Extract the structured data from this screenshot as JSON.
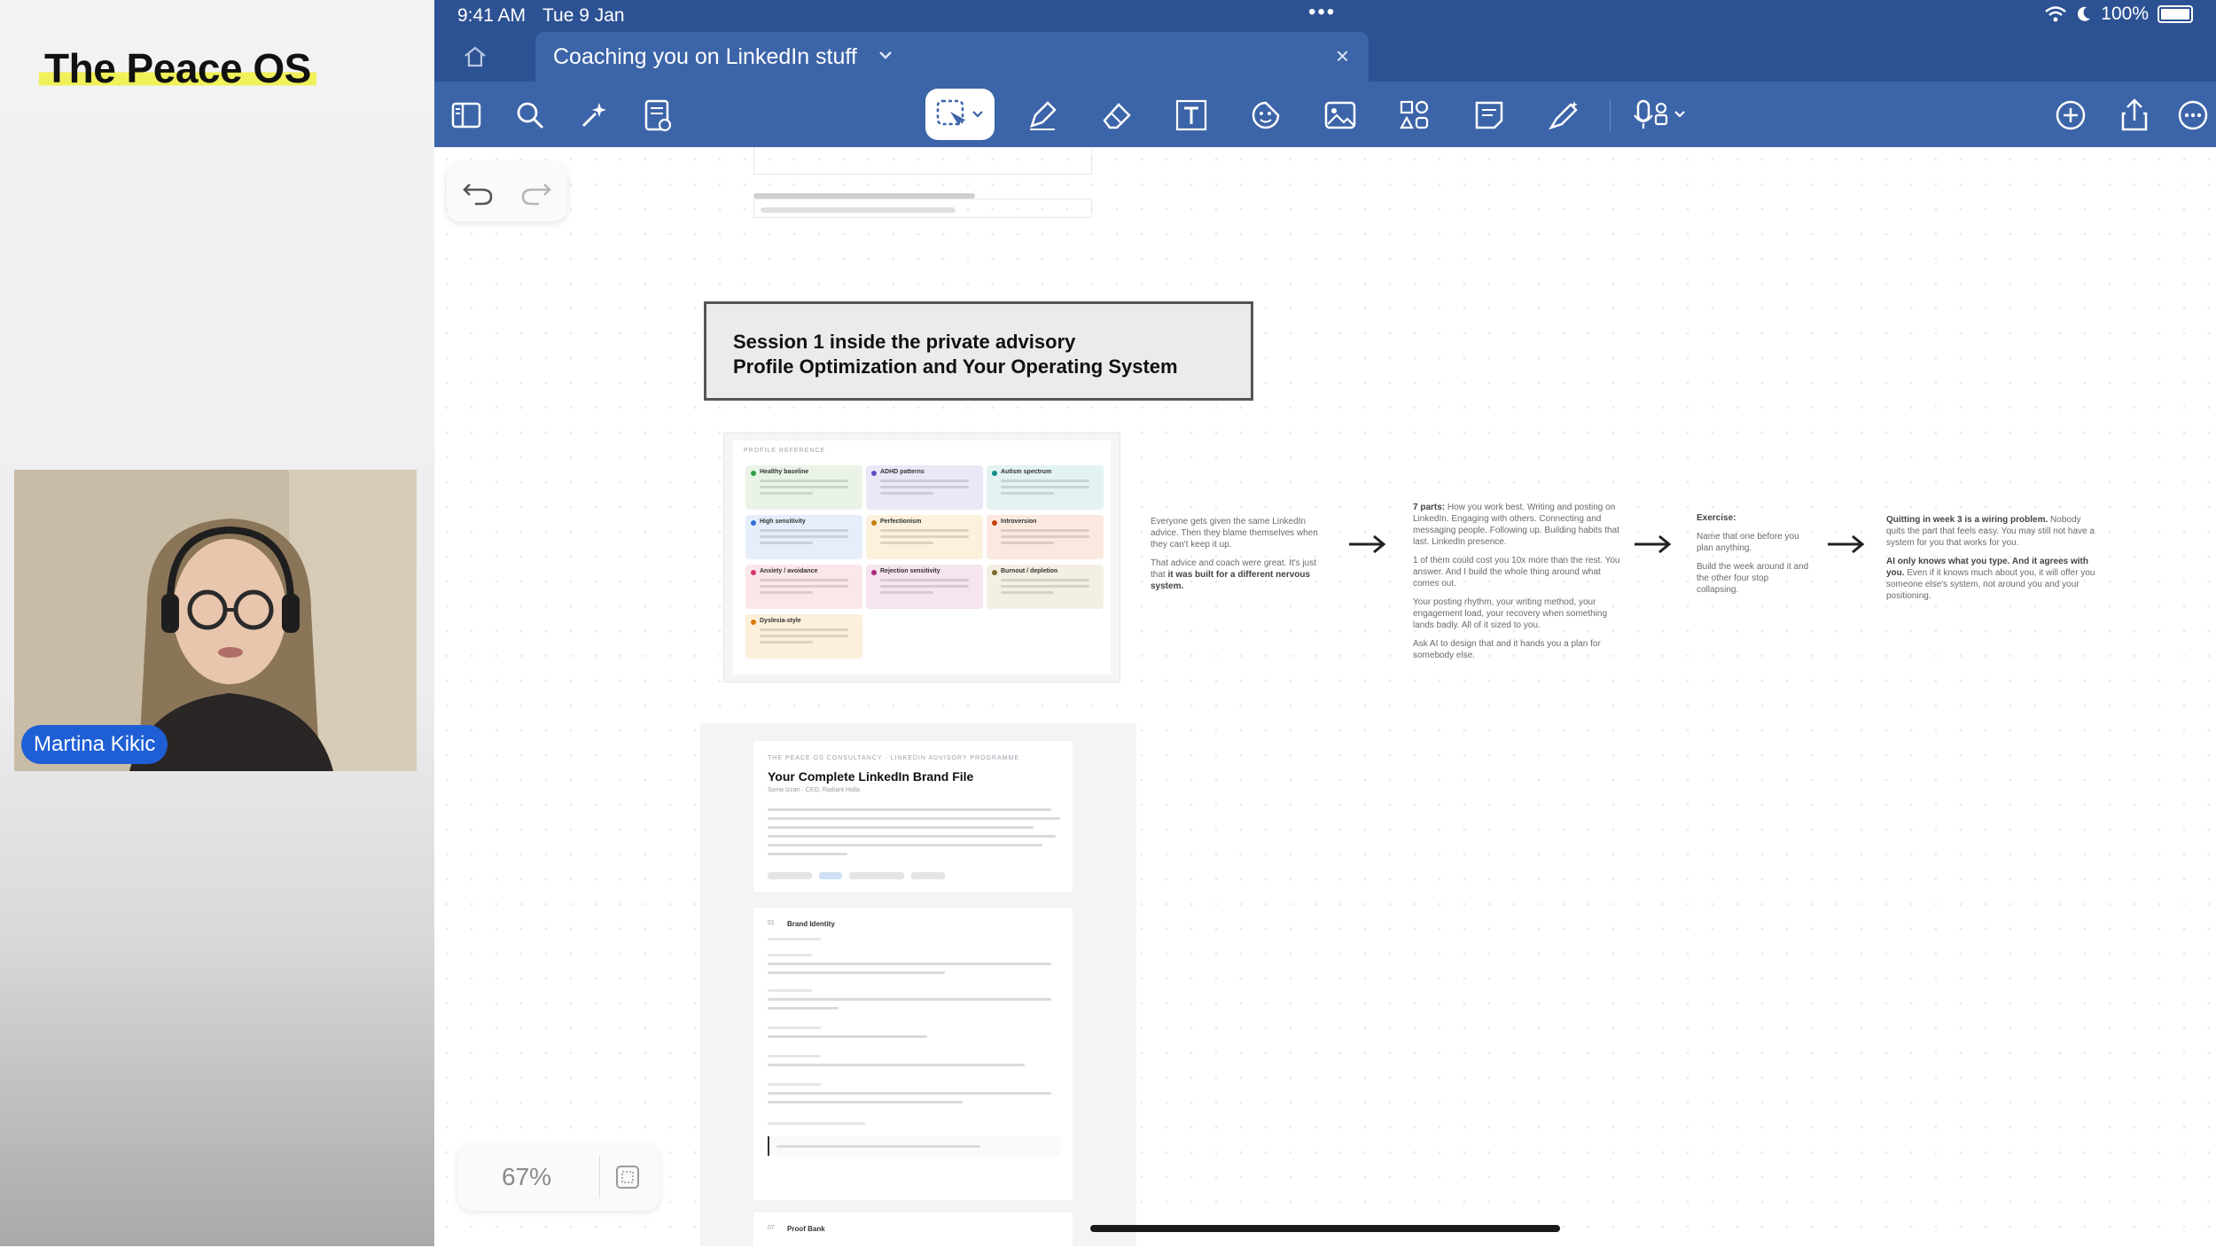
{
  "brand": {
    "title": "The Peace OS"
  },
  "presenter": {
    "name": "Martina Kikic"
  },
  "status_bar": {
    "time": "9:41 AM",
    "date": "Tue 9 Jan",
    "battery": "100%"
  },
  "tab": {
    "title": "Coaching you on LinkedIn stuff"
  },
  "toolbar": {
    "left_tools": [
      "sidebar-icon",
      "search-icon",
      "sparkle-icon",
      "page-icon"
    ],
    "center_tools": [
      "lasso-icon",
      "pen-icon",
      "eraser-icon",
      "text-box-icon",
      "sticker-icon",
      "image-icon",
      "shapes-icon",
      "sticky-note-icon",
      "highlighter-icon",
      "microphone-icon"
    ],
    "right_tools": [
      "add-icon",
      "share-icon",
      "more-icon"
    ],
    "active_tool": "lasso-icon"
  },
  "session": {
    "line1": "Session 1 inside the private advisory",
    "line2": "Profile Optimization and Your Operating System"
  },
  "profile_card": {
    "header": "PROFILE REFERENCE",
    "cards": [
      {
        "title": "Healthy baseline",
        "dot": "#2f9e44",
        "bg": "#e9f4e6"
      },
      {
        "title": "ADHD patterns",
        "dot": "#5b4fc7",
        "bg": "#ebe7f6"
      },
      {
        "title": "Autism spectrum",
        "dot": "#138a8a",
        "bg": "#e3f3f1"
      },
      {
        "title": "High sensitivity",
        "dot": "#2f6fd6",
        "bg": "#e6eefb"
      },
      {
        "title": "Perfectionism",
        "dot": "#c77d0a",
        "bg": "#fbf1dd"
      },
      {
        "title": "Introversion",
        "dot": "#c2410c",
        "bg": "#fbe9e0"
      },
      {
        "title": "Anxiety / avoidance",
        "dot": "#d6336c",
        "bg": "#fbe6ea"
      },
      {
        "title": "Rejection sensitivity",
        "dot": "#b02a7a",
        "bg": "#f6e4ef"
      },
      {
        "title": "Burnout / depletion",
        "dot": "#7a6a2f",
        "bg": "#f3efe2"
      },
      {
        "title": "Dyslexia-style",
        "dot": "#d97706",
        "bg": "#fcf0db"
      }
    ]
  },
  "flow": {
    "block1": {
      "text": "Everyone gets given the same LinkedIn advice. Then they blame themselves when they can't keep it up.",
      "pre": "That advice and coach were great. It's just that ",
      "bold": "it was built for a different nervous system."
    },
    "block2": {
      "bold": "7 parts:",
      "text": " How you work best. Writing and posting on LinkedIn. Engaging with others. Connecting and messaging people. Following up. Building habits that last. LinkedIn presence.",
      "p2": "1 of them could cost you 10x more than the rest. You answer. And I build the whole thing around what comes out.",
      "p3": "Your posting rhythm, your writing method, your engagement load, your recovery when something lands badly. All of it sized to you.",
      "p4": "Ask AI to design that and it hands you a plan for somebody else."
    },
    "block3": {
      "bold": "Exercise:",
      "p1": "Name that one before you plan anything.",
      "p2": "Build the week around it and the other four stop collapsing."
    },
    "block4": {
      "bold1": "Quitting in week 3 is a wiring problem.",
      "text1": " Nobody quits the part that feels easy. You may still not have a system for you that works for you.",
      "bold2": "AI only knows what you type. And it agrees with you.",
      "text2": " Even if it knows much about you, it will offer you someone else's system, not around you and your positioning."
    }
  },
  "brand_file": {
    "kicker": "THE PEACE OS CONSULTANCY · LINKEDIN ADVISORY PROGRAMME",
    "title": "Your Complete LinkedIn Brand File",
    "subtitle": "Sonia Izzari · CEO, Radiant Holla",
    "section_badge": "01",
    "section_title": "Brand Identity",
    "proof_badge": "07",
    "proof_title": "Proof Bank"
  },
  "zoom": {
    "level": "67%"
  },
  "colors": {
    "accent": "#2d5293",
    "toolbar": "#3c64a8",
    "highlight": "#f0f05a",
    "name_badge": "#1f5fd6"
  }
}
